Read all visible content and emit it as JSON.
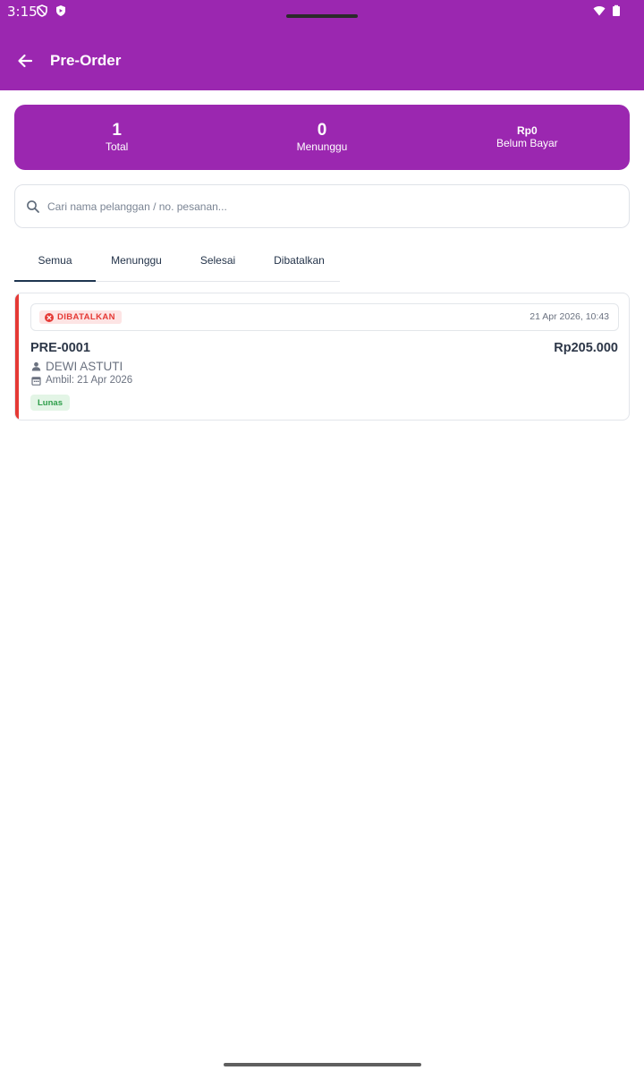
{
  "status_bar": {
    "time": "3:15"
  },
  "header": {
    "title": "Pre-Order"
  },
  "summary": {
    "total_value": "1",
    "total_label": "Total",
    "waiting_value": "0",
    "waiting_label": "Menunggu",
    "unpaid_value": "Rp0",
    "unpaid_label": "Belum Bayar"
  },
  "search": {
    "placeholder": "Cari nama pelanggan / no. pesanan..."
  },
  "tabs": [
    {
      "label": "Semua",
      "active": true
    },
    {
      "label": "Menunggu",
      "active": false
    },
    {
      "label": "Selesai",
      "active": false
    },
    {
      "label": "Dibatalkan",
      "active": false
    }
  ],
  "orders": [
    {
      "status": "DIBATALKAN",
      "date": "21 Apr 2026, 10:43",
      "number": "PRE-0001",
      "amount": "Rp205.000",
      "customer": "DEWI ASTUTI",
      "pickup": "Ambil: 21 Apr 2026",
      "payment": "Lunas"
    }
  ],
  "colors": {
    "brand": "#9b27b0",
    "cancelled": "#e53935",
    "paid": "#2e9e4a",
    "tab_indicator": "#1e3550"
  }
}
